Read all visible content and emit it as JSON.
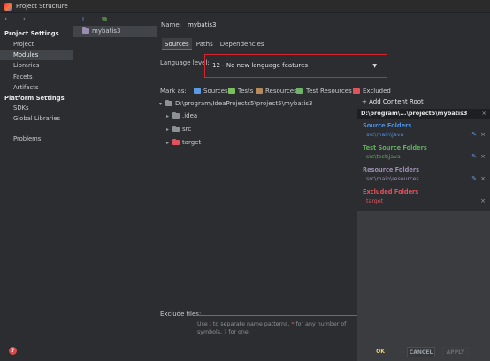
{
  "window": {
    "title": "Project Structure"
  },
  "nav": {
    "arrows": "← →",
    "section_project": "Project Settings",
    "project_items": [
      "Project",
      "Modules",
      "Libraries",
      "Facets",
      "Artifacts"
    ],
    "section_platform": "Platform Settings",
    "platform_items": [
      "SDKs",
      "Global Libraries"
    ],
    "problems": "Problems",
    "help": "?"
  },
  "modules": {
    "toolbar": [
      "+",
      "−",
      "⧉"
    ],
    "items": [
      "mybatis3"
    ]
  },
  "main": {
    "name_label": "Name:",
    "name_value": "mybatis3",
    "tabs": [
      "Sources",
      "Paths",
      "Dependencies"
    ],
    "language_label": "Language level:",
    "language_value": "12 - No new language features",
    "mark_as_label": "Mark as:",
    "mark_as": [
      {
        "label": "Sources",
        "color": "#5b9be6"
      },
      {
        "label": "Tests",
        "color": "#7bbf5c"
      },
      {
        "label": "Resources",
        "color": "#b58a5a"
      },
      {
        "label": "Test Resources",
        "color": "#6db36a"
      },
      {
        "label": "Excluded",
        "color": "#e2525c"
      }
    ],
    "tree": {
      "root": "D:\\program\\IdeaProjects5\\project5\\mybatis3",
      "children": [
        {
          "label": ".idea",
          "color": "#8d9096"
        },
        {
          "label": "src",
          "color": "#8d9096"
        },
        {
          "label": "target",
          "color": "#e2525c"
        }
      ]
    },
    "content_root": {
      "add_label": "+ Add Content Root",
      "path": "D:\\program\\...\\project5\\mybatis3",
      "close": "×",
      "groups": [
        {
          "title": "Source Folders",
          "path": "src\\main\\java",
          "color": "#4a90e2"
        },
        {
          "title": "Test Source Folders",
          "path": "src\\test\\java",
          "color": "#5fae5b"
        },
        {
          "title": "Resource Folders",
          "path": "src\\main\\resources",
          "color": "#9b8db0"
        },
        {
          "title": "Excluded Folders",
          "path": "target",
          "color": "#e2525c"
        }
      ]
    },
    "exclude_label": "Exclude files:",
    "hint_before": "Use ",
    "hint_sep": ";",
    "hint_mid": " to separate name patterns, ",
    "hint_star": "*",
    "hint_mid2": " for any number of symbols, ",
    "hint_q": "?",
    "hint_end": " for one."
  },
  "buttons": {
    "ok": "OK",
    "cancel": "CANCEL",
    "apply": "APPLY"
  }
}
